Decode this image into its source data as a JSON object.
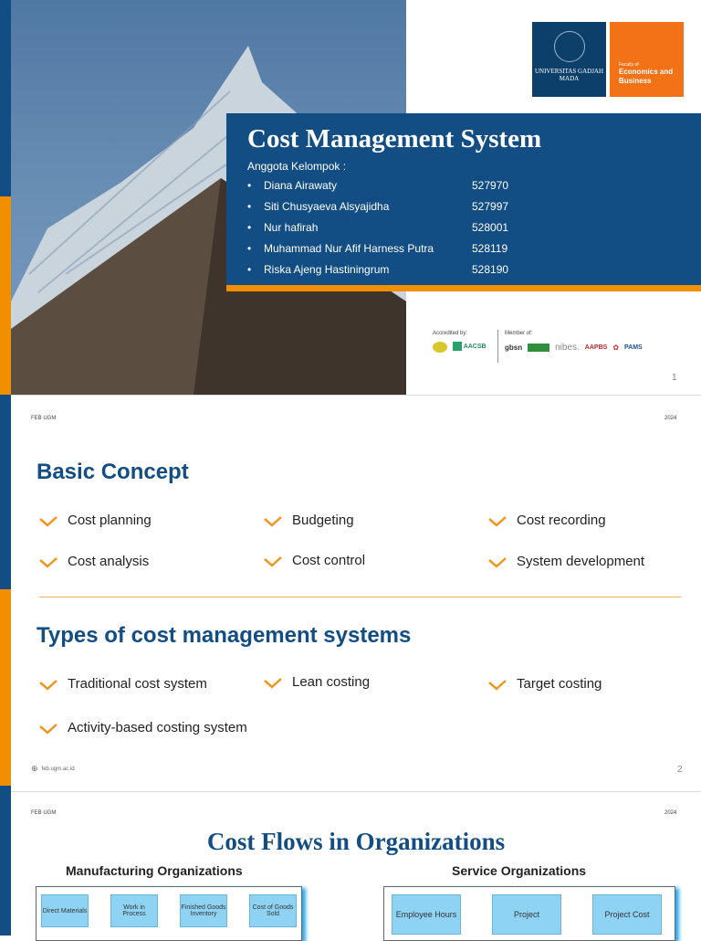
{
  "slide1": {
    "logo_ugm": "UNIVERSITAS GADJAH MADA",
    "logo_feb_small": "Faculty of",
    "logo_feb_big": "Economics and Business",
    "title": "Cost Management System",
    "subtitle": "Anggota Kelompok :",
    "members": [
      {
        "name": "Diana Airawaty",
        "id": "527970"
      },
      {
        "name": "Siti Chusyaeva Alsyajidha",
        "id": "527997"
      },
      {
        "name": "Nur hafirah",
        "id": "528001"
      },
      {
        "name": "Muhammad Nur Afif Harness Putra",
        "id": "528119"
      },
      {
        "name": "Riska Ajeng Hastiningrum",
        "id": "528190"
      }
    ],
    "accredited": "Accredited by:",
    "accreditors": [
      "AACSB"
    ],
    "member_of": "Member of:",
    "memberships": [
      "gbsn",
      "nibes.",
      "AAPBS",
      "PAMS"
    ],
    "page": "1"
  },
  "slide2": {
    "header_left": "FEB UGM",
    "header_right": "2024",
    "heading1": "Basic Concept",
    "concepts": [
      "Cost planning",
      "Budgeting",
      "Cost recording",
      "Cost analysis",
      "Cost control",
      "System development"
    ],
    "heading2": "Types of cost management systems",
    "types": [
      "Traditional cost system",
      "Lean costing",
      "Target costing",
      "Activity-based costing system"
    ],
    "website": "feb.ugm.ac.id",
    "page": "2"
  },
  "slide3": {
    "header_left": "FEB UGM",
    "header_right": "2024",
    "title": "Cost Flows in Organizations",
    "manufacturing": {
      "label": "Manufacturing Organizations",
      "boxes": [
        "Direct Materials",
        "Work in Process",
        "Finished Goods Inventory",
        "Cost of Goods Sold"
      ]
    },
    "service": {
      "label": "Service Organizations",
      "boxes": [
        "Employee Hours",
        "Project",
        "Project Cost"
      ]
    }
  },
  "colors": {
    "blue": "#124d83",
    "orange": "#f18f00"
  }
}
